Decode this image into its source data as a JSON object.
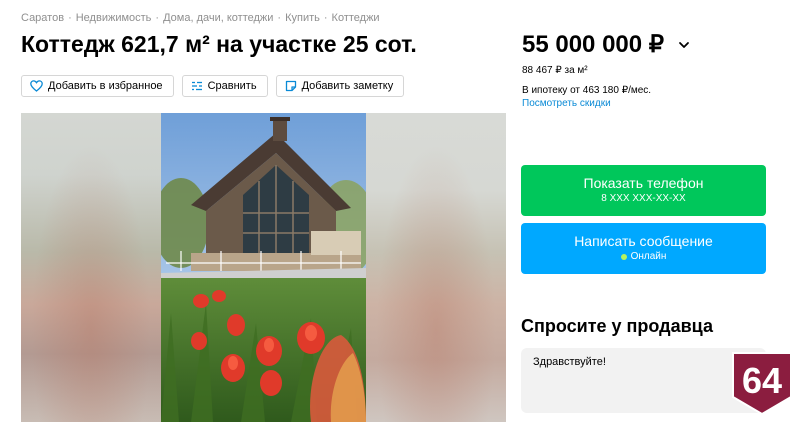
{
  "breadcrumb": [
    "Саратов",
    "Недвижимость",
    "Дома, дачи, коттеджи",
    "Купить",
    "Коттеджи"
  ],
  "breadcrumb_separator": "·",
  "title": "Коттедж 621,7 м² на участке 25 сот.",
  "actions": {
    "favorite": {
      "label": "Добавить в избранное",
      "icon": "heart-icon"
    },
    "compare": {
      "label": "Сравнить",
      "icon": "compare-icon"
    },
    "note": {
      "label": "Добавить заметку",
      "icon": "note-icon"
    }
  },
  "price": {
    "value": "55 000 000 ₽",
    "per_sqm": "88 467 ₽ за м²",
    "mortgage": "В ипотеку от 463 180 ₽/мес.",
    "discounts_link": "Посмотреть скидки",
    "chevron_icon": "chevron-down-icon"
  },
  "contact": {
    "phone_button": "Показать телефон",
    "phone_masked": "8 XXX XXX-XX-XX",
    "message_button": "Написать сообщение",
    "online_status": "Онлайн"
  },
  "ask": {
    "title": "Спросите у продавца",
    "message": "Здравствуйте!"
  },
  "watermark": {
    "text": "64",
    "color": "#8b1d3f"
  },
  "colors": {
    "phone_button": "#00c75b",
    "message_button": "#00a8ff",
    "link": "#0a8ad6",
    "breadcrumb": "#8f8f8f"
  }
}
